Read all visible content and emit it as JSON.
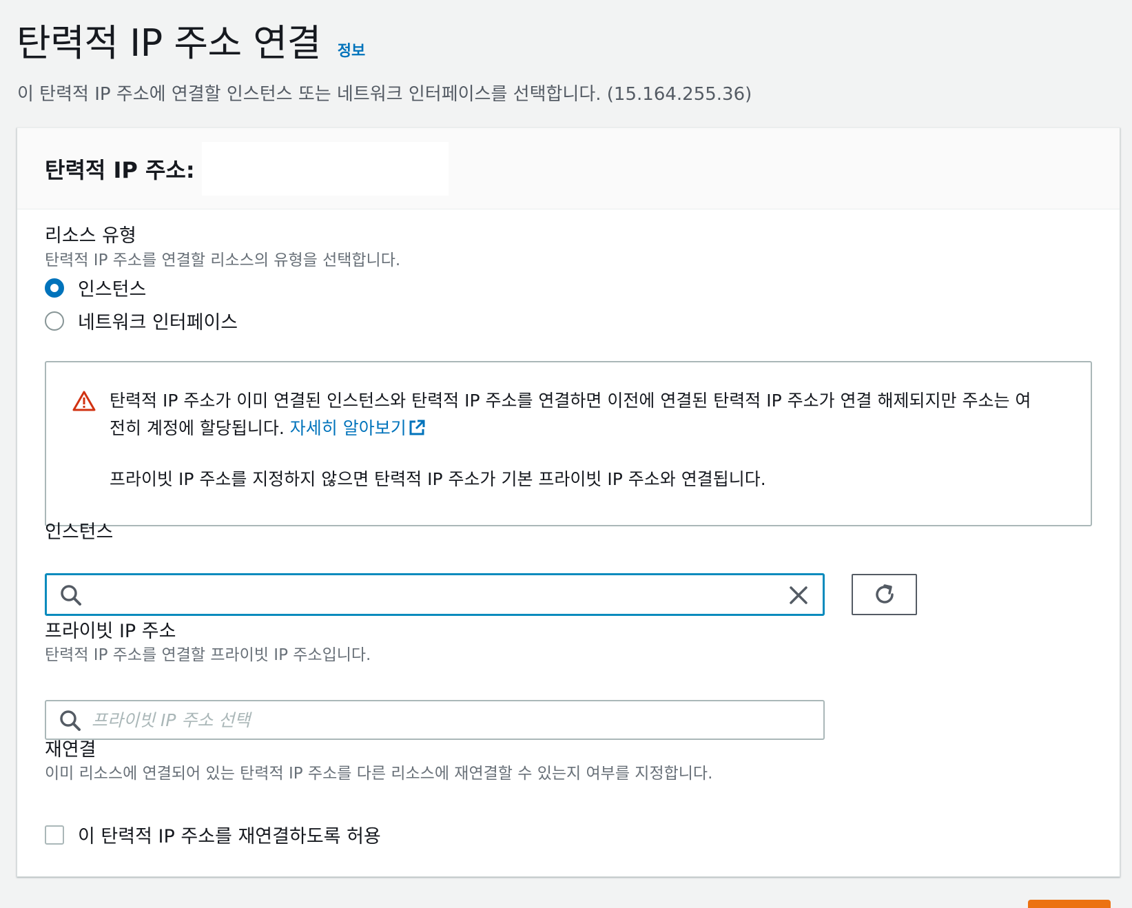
{
  "header": {
    "title": "탄력적 IP 주소 연결",
    "info_link": "정보",
    "description": "이 탄력적 IP 주소에 연결할 인스턴스 또는 네트워크 인터페이스를 선택합니다. (15.164.255.36)"
  },
  "panel": {
    "title": "탄력적 IP 주소:"
  },
  "resource_type": {
    "label": "리소스 유형",
    "description": "탄력적 IP 주소를 연결할 리소스의 유형을 선택합니다.",
    "options": [
      {
        "label": "인스턴스",
        "selected": true
      },
      {
        "label": "네트워크 인터페이스",
        "selected": false
      }
    ]
  },
  "alert": {
    "text": "탄력적 IP 주소가 이미 연결된 인스턴스와 탄력적 IP 주소를 연결하면 이전에 연결된 탄력적 IP 주소가 연결 해제되지만 주소는 여전히 계정에 할당됩니다. ",
    "link": "자세히 알아보기",
    "text2": "프라이빗 IP 주소를 지정하지 않으면 탄력적 IP 주소가 기본 프라이빗 IP 주소와 연결됩니다.",
    "icon": "warning-icon"
  },
  "instance": {
    "label": "인스턴스",
    "value": "",
    "icons": {
      "search": "search-icon",
      "clear": "close-icon",
      "refresh": "refresh-icon"
    }
  },
  "private_ip": {
    "label": "프라이빗 IP 주소",
    "description": "탄력적 IP 주소를 연결할 프라이빗 IP 주소입니다.",
    "placeholder": "프라이빗 IP 주소 선택"
  },
  "reassociation": {
    "label": "재연결",
    "description": "이미 리소스에 연결되어 있는 탄력적 IP 주소를 다른 리소스에 재연결할 수 있는지 여부를 지정합니다.",
    "checkbox_label": "이 탄력적 IP 주소를 재연결하도록 허용",
    "checked": false
  },
  "colors": {
    "link": "#0073bb",
    "warning": "#d13212",
    "focus": "#0a8bbd",
    "primary": "#ec7211"
  }
}
